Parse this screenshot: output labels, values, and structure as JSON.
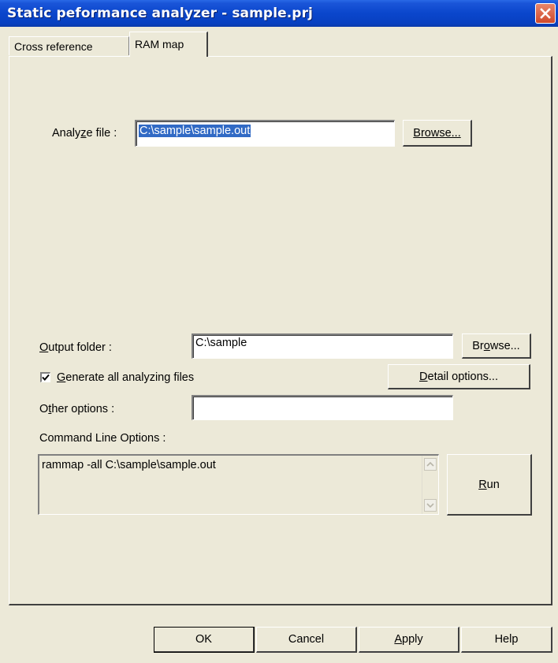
{
  "window": {
    "title": "Static peformance analyzer - sample.prj"
  },
  "tabs": [
    {
      "label": "Cross reference"
    },
    {
      "label": "RAM map"
    }
  ],
  "analyze": {
    "label_pre": "Analy",
    "label_u": "z",
    "label_post": "e file :",
    "value": "C:\\sample\\sample.out",
    "browse_label": "Browse..."
  },
  "output": {
    "label_u": "O",
    "label_post": "utput folder :",
    "value": "C:\\sample",
    "browse_pre": "Br",
    "browse_u": "o",
    "browse_post": "wse..."
  },
  "generate": {
    "checked": true,
    "label_u": "G",
    "label_post": "enerate all analyzing files"
  },
  "detail": {
    "label_u": "D",
    "label_post": "etail options..."
  },
  "other": {
    "label_pre": "O",
    "label_u": "t",
    "label_post": "her options :",
    "value": ""
  },
  "command": {
    "label": "Command Line Options :",
    "value": "rammap -all C:\\sample\\sample.out"
  },
  "run": {
    "label_u": "R",
    "label_post": "un"
  },
  "buttons": {
    "ok": "OK",
    "cancel": "Cancel",
    "apply_u": "A",
    "apply_post": "pply",
    "help": "Help"
  }
}
